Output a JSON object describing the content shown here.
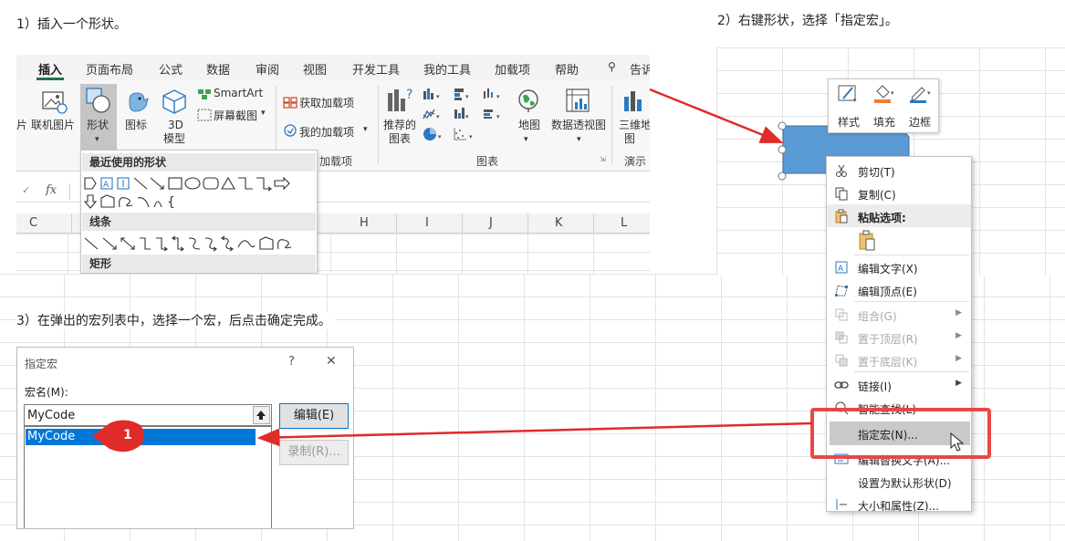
{
  "captions": {
    "step1": "1）插入一个形状。",
    "step2": "2）右键形状，选择「指定宏」。",
    "step3": "3）在弹出的宏列表中，选择一个宏，后点击确定完成。"
  },
  "ribbon": {
    "tabs": [
      "插入",
      "页面布局",
      "公式",
      "数据",
      "审阅",
      "视图",
      "开发工具",
      "我的工具",
      "加载项",
      "帮助",
      "告诉"
    ],
    "active_tab": "插入",
    "left_cut_label": "片",
    "buttons": {
      "online_pictures": "联机图片",
      "shapes": "形状",
      "icons": "图标",
      "model3d_line1": "3D",
      "model3d_line2": "模型",
      "smartart": "SmartArt",
      "screenshot": "屏幕截图",
      "get_addins": "获取加载项",
      "my_addins": "我的加载项",
      "recommended_line1": "推荐的",
      "recommended_line2": "图表",
      "maps": "地图",
      "pivot_chart": "数据透视图",
      "map3d_line1": "三维地",
      "map3d_line2": "图"
    },
    "group_labels": {
      "addins": "加载项",
      "charts": "图表",
      "tours": "演示"
    },
    "formula_fx": "fx",
    "columns": [
      "C",
      "H",
      "I",
      "J",
      "K",
      "L"
    ],
    "shapes_dropdown": {
      "recent": "最近使用的形状",
      "lines": "线条",
      "rectangles": "矩形"
    }
  },
  "mini_toolbar": {
    "style": "样式",
    "fill": "填充",
    "border": "边框"
  },
  "context_menu": {
    "items": [
      {
        "label": "剪切(T)",
        "icon": "scissors-icon",
        "enabled": true
      },
      {
        "label": "复制(C)",
        "icon": "copy-icon",
        "enabled": true
      },
      {
        "label": "粘贴选项:",
        "icon": "clipboard-icon",
        "enabled": true
      },
      {
        "label": "编辑文字(X)",
        "icon": "edit-text-icon",
        "enabled": true
      },
      {
        "label": "编辑顶点(E)",
        "icon": "edit-points-icon",
        "enabled": true
      },
      {
        "label": "组合(G)",
        "icon": "group-icon",
        "enabled": false
      },
      {
        "label": "置于顶层(R)",
        "icon": "bring-front-icon",
        "enabled": false
      },
      {
        "label": "置于底层(K)",
        "icon": "send-back-icon",
        "enabled": false
      },
      {
        "label": "链接(I)",
        "icon": "link-icon",
        "enabled": true
      },
      {
        "label": "智能查找(L)",
        "icon": "smart-lookup-icon",
        "enabled": true
      },
      {
        "label": "指定宏(N)...",
        "icon": "",
        "enabled": true,
        "highlighted": true
      },
      {
        "label": "编辑替换文字(A)...",
        "icon": "alt-text-icon",
        "enabled": true
      },
      {
        "label": "设置为默认形状(D)",
        "icon": "",
        "enabled": true
      },
      {
        "label": "大小和属性(Z)...",
        "icon": "size-icon",
        "enabled": true
      }
    ]
  },
  "dialog": {
    "title": "指定宏",
    "help": "?",
    "close": "✕",
    "macro_name_label": "宏名(M):",
    "macro_name_value": "MyCode",
    "list_items": [
      "MyCode"
    ],
    "edit_button": "编辑(E)",
    "record_button": "录制(R)...",
    "badge": "1"
  },
  "colors": {
    "excel_green": "#217346",
    "selection_blue": "#0078d7",
    "shape_blue": "#5b9bd5",
    "annotation_red": "#e02b2b",
    "highlight_box": "#e84747"
  }
}
